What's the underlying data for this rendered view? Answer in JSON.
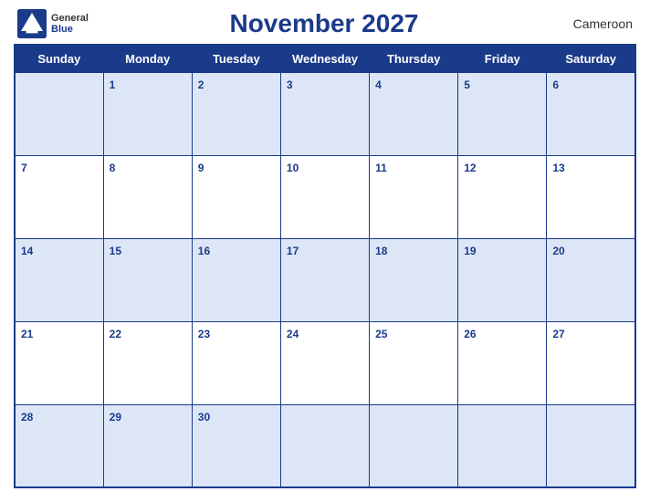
{
  "header": {
    "logo_general": "General",
    "logo_blue": "Blue",
    "title": "November 2027",
    "country": "Cameroon"
  },
  "weekdays": [
    "Sunday",
    "Monday",
    "Tuesday",
    "Wednesday",
    "Thursday",
    "Friday",
    "Saturday"
  ],
  "weeks": [
    [
      null,
      1,
      2,
      3,
      4,
      5,
      6
    ],
    [
      7,
      8,
      9,
      10,
      11,
      12,
      13
    ],
    [
      14,
      15,
      16,
      17,
      18,
      19,
      20
    ],
    [
      21,
      22,
      23,
      24,
      25,
      26,
      27
    ],
    [
      28,
      29,
      30,
      null,
      null,
      null,
      null
    ]
  ]
}
